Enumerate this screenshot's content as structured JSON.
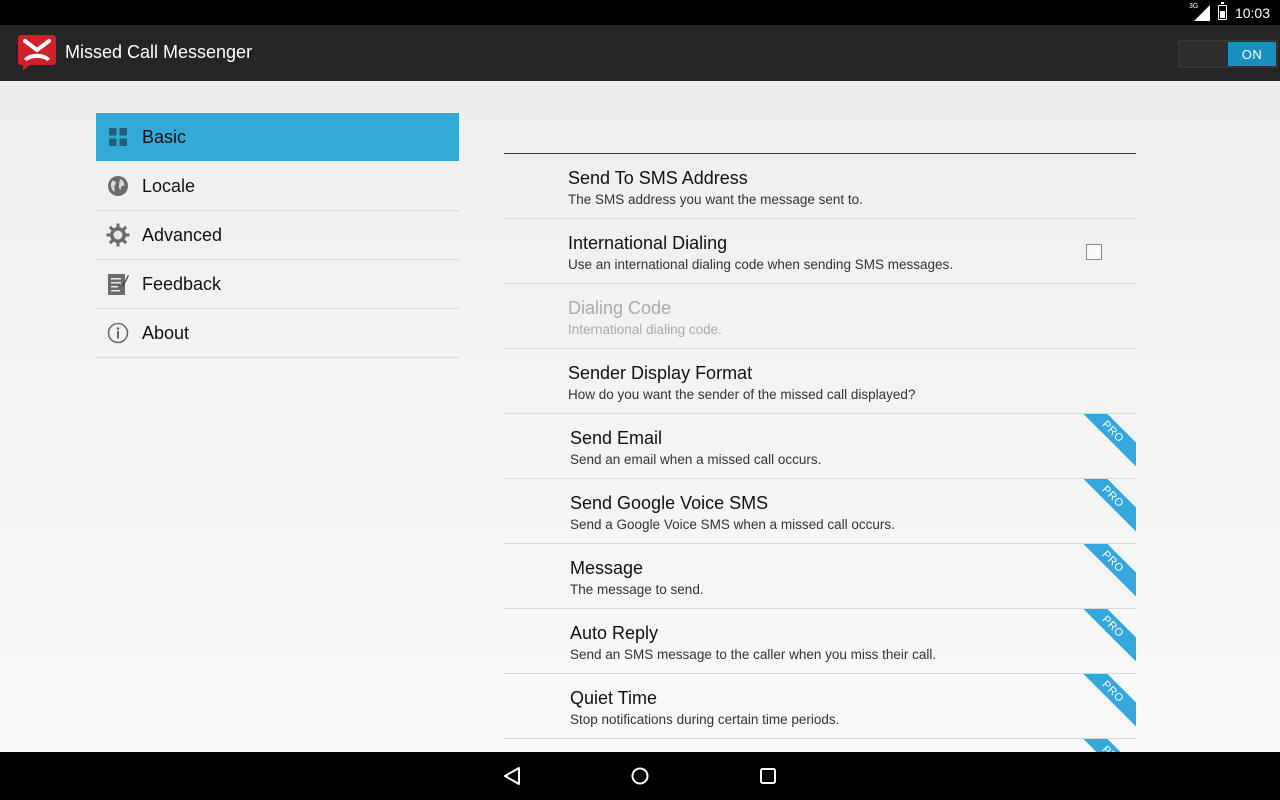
{
  "status_bar": {
    "network_label": "3G",
    "time": "10:03",
    "icons": [
      "signal-3g-icon",
      "battery-icon"
    ]
  },
  "action_bar": {
    "title": "Missed Call Messenger",
    "logo_icon": "missed-call-logo-icon",
    "switch_label": "ON",
    "switch_state": "on"
  },
  "headers": [
    {
      "label": "Basic",
      "icon": "grid-icon",
      "active": true
    },
    {
      "label": "Locale",
      "icon": "globe-icon",
      "active": false
    },
    {
      "label": "Advanced",
      "icon": "gear-icon",
      "active": false
    },
    {
      "label": "Feedback",
      "icon": "feedback-icon",
      "active": false
    },
    {
      "label": "About",
      "icon": "info-icon",
      "active": false
    }
  ],
  "preferences": [
    {
      "title": "Send To SMS Address",
      "summary": "The SMS address you want the message sent to.",
      "enabled": true,
      "pro": false
    },
    {
      "title": "International Dialing",
      "summary": "Use an international dialing code when sending SMS messages.",
      "enabled": true,
      "pro": false,
      "checkbox": false
    },
    {
      "title": "Dialing Code",
      "summary": "International dialing code.",
      "enabled": false,
      "pro": false
    },
    {
      "title": "Sender Display Format",
      "summary": "How do you want the sender of the missed call displayed?",
      "enabled": true,
      "pro": false
    },
    {
      "title": "Send Email",
      "summary": "Send an email when a missed call occurs.",
      "enabled": true,
      "pro": true
    },
    {
      "title": "Send Google Voice SMS",
      "summary": "Send a Google Voice SMS when a missed call occurs.",
      "enabled": true,
      "pro": true
    },
    {
      "title": "Message",
      "summary": "The message to send.",
      "enabled": true,
      "pro": true
    },
    {
      "title": "Auto Reply",
      "summary": "Send an SMS message to the caller when you miss their call.",
      "enabled": true,
      "pro": true
    },
    {
      "title": "Quiet Time",
      "summary": "Stop notifications during certain time periods.",
      "enabled": true,
      "pro": true
    }
  ],
  "pro_badge": "PRO",
  "colors": {
    "accent": "#33a9d7",
    "switch_on": "#1a8fbf",
    "action_bar": "#252525",
    "logo_red": "#d0202a"
  },
  "nav_bar": {
    "buttons": [
      "back-icon",
      "home-icon",
      "recents-icon"
    ]
  }
}
